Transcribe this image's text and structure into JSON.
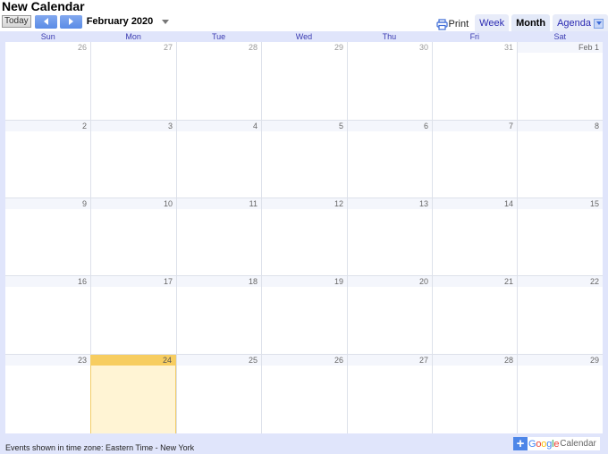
{
  "title": "New Calendar",
  "nav": {
    "today_label": "Today",
    "prev_icon": "chevron-left-icon",
    "next_icon": "chevron-right-icon",
    "month_label": "February 2020"
  },
  "toolbar": {
    "print_label": "Print",
    "tabs": [
      {
        "label": "Week",
        "active": false
      },
      {
        "label": "Month",
        "active": true
      },
      {
        "label": "Agenda",
        "active": false
      }
    ]
  },
  "weekdays": [
    "Sun",
    "Mon",
    "Tue",
    "Wed",
    "Thu",
    "Fri",
    "Sat"
  ],
  "weeks": [
    [
      {
        "label": "26",
        "other": true
      },
      {
        "label": "27",
        "other": true
      },
      {
        "label": "28",
        "other": true
      },
      {
        "label": "29",
        "other": true
      },
      {
        "label": "30",
        "other": true
      },
      {
        "label": "31",
        "other": true
      },
      {
        "label": "Feb 1",
        "other": false
      }
    ],
    [
      {
        "label": "2"
      },
      {
        "label": "3"
      },
      {
        "label": "4"
      },
      {
        "label": "5"
      },
      {
        "label": "6"
      },
      {
        "label": "7"
      },
      {
        "label": "8"
      }
    ],
    [
      {
        "label": "9"
      },
      {
        "label": "10"
      },
      {
        "label": "11"
      },
      {
        "label": "12"
      },
      {
        "label": "13"
      },
      {
        "label": "14"
      },
      {
        "label": "15"
      }
    ],
    [
      {
        "label": "16"
      },
      {
        "label": "17"
      },
      {
        "label": "18"
      },
      {
        "label": "19"
      },
      {
        "label": "20"
      },
      {
        "label": "21"
      },
      {
        "label": "22"
      }
    ],
    [
      {
        "label": "23"
      },
      {
        "label": "24",
        "today": true
      },
      {
        "label": "25"
      },
      {
        "label": "26"
      },
      {
        "label": "27"
      },
      {
        "label": "28"
      },
      {
        "label": "29"
      }
    ]
  ],
  "footer": {
    "timezone_text": "Events shown in time zone: Eastern Time - New York",
    "badge": {
      "plus": "+",
      "google": "Google",
      "calendar": "Calendar"
    }
  },
  "colors": {
    "today_header": "#f7cd60",
    "today_body": "#fff4d4",
    "accent": "#4d86e8"
  }
}
